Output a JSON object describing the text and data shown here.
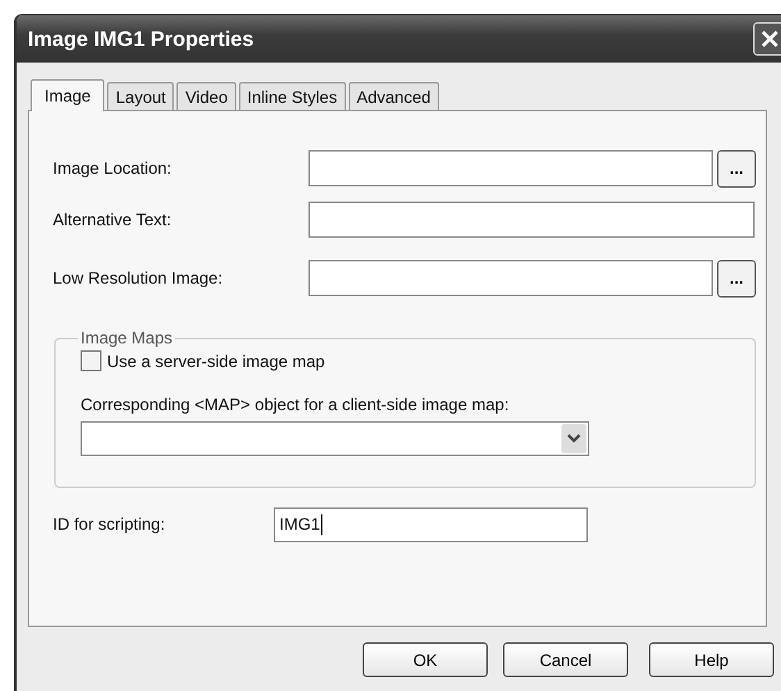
{
  "window": {
    "title": "Image IMG1 Properties"
  },
  "tabs": [
    {
      "label": "Image",
      "selected": true
    },
    {
      "label": "Layout",
      "selected": false
    },
    {
      "label": "Video",
      "selected": false
    },
    {
      "label": "Inline Styles",
      "selected": false
    },
    {
      "label": "Advanced",
      "selected": false
    }
  ],
  "fields": [
    {
      "kind": "browse",
      "label": "Image Location:",
      "button": "..."
    },
    {
      "kind": "text",
      "label": "Alternative Text:"
    },
    {
      "kind": "browse",
      "label": "Low Resolution Image:",
      "button": "..."
    }
  ],
  "image_maps": {
    "title": "Image Maps",
    "checkbox": {
      "label": "Use a server-side image map",
      "checked": false
    },
    "map_label": "Corresponding <MAP> object for a client-side image map:"
  },
  "id_field": {
    "label": "ID for scripting:",
    "value": "IMG1",
    "focused": true
  },
  "buttons": [
    "OK",
    "Cancel",
    "Help"
  ]
}
